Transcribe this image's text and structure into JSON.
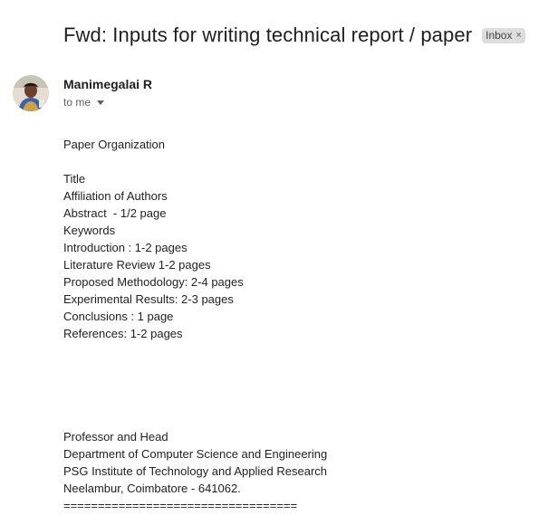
{
  "email": {
    "subject": "Fwd: Inputs for writing technical report / paper",
    "label_chip": "Inbox",
    "label_chip_close": "×",
    "sender_name": "Manimegalai R",
    "recipient_text": "to me"
  },
  "body": {
    "heading": "Paper Organization",
    "outline": [
      "Title",
      "Affiliation of Authors",
      "Abstract  - 1/2 page",
      "Keywords",
      "Introduction : 1-2 pages",
      "Literature Review 1-2 pages",
      "Proposed Methodology: 2-4 pages",
      "Experimental Results: 2-3 pages",
      "Conclusions : 1 page",
      "References: 1-2 pages"
    ],
    "signature": [
      "Professor and Head",
      "Department of Computer Science and Engineering",
      "PSG Institute of Technology and Applied Research",
      "Neelambur, Coimbatore - 641062.",
      "=================================="
    ]
  }
}
